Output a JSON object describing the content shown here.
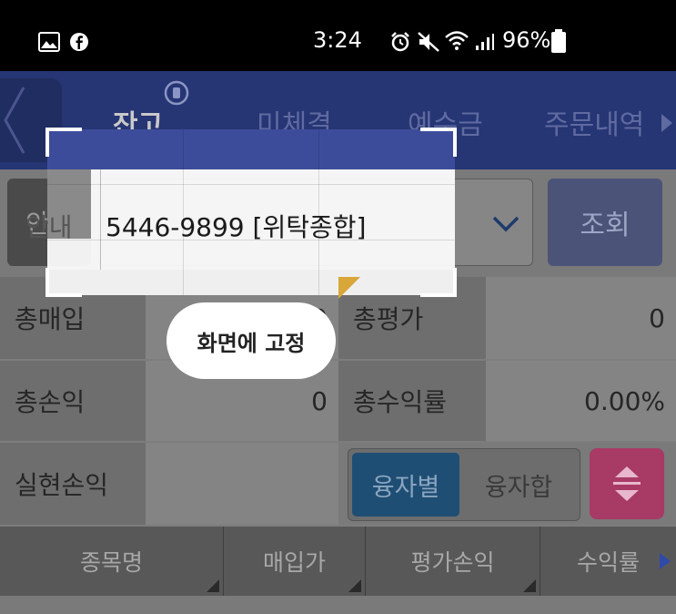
{
  "status_bar": {
    "time": "3:24",
    "battery": "96%",
    "icons": [
      "gallery-icon",
      "facebook-icon",
      "alarm-icon",
      "mute-icon",
      "wifi-icon",
      "signal-icon",
      "battery-icon"
    ]
  },
  "tabs": [
    {
      "label": "잔고",
      "active": true
    },
    {
      "label": "미체결",
      "active": false
    },
    {
      "label": "예수금",
      "active": false
    },
    {
      "label": "주문내역",
      "active": false
    }
  ],
  "account": {
    "guide_label": "안내",
    "account_value": "5446-9899 [위탁종합]",
    "query_label": "조회"
  },
  "summary": {
    "total_purchase_label": "총매입",
    "total_purchase_value": "0",
    "total_eval_label": "총평가",
    "total_eval_value": "0",
    "total_pnl_label": "총손익",
    "total_pnl_value": "0",
    "total_return_label": "총수익률",
    "total_return_value": "0.00%",
    "realized_pnl_label": "실현손익",
    "by_loan_label": "융자별",
    "loan_sum_label": "융자합"
  },
  "columns": [
    "종목명",
    "매입가",
    "평가손익",
    "수익률"
  ],
  "overlay": {
    "pin_label": "화면에 고정"
  },
  "colors": {
    "tab_bar": "#263574",
    "accent_pink": "#c2457a",
    "by_loan_blue": "#1f4e74"
  }
}
